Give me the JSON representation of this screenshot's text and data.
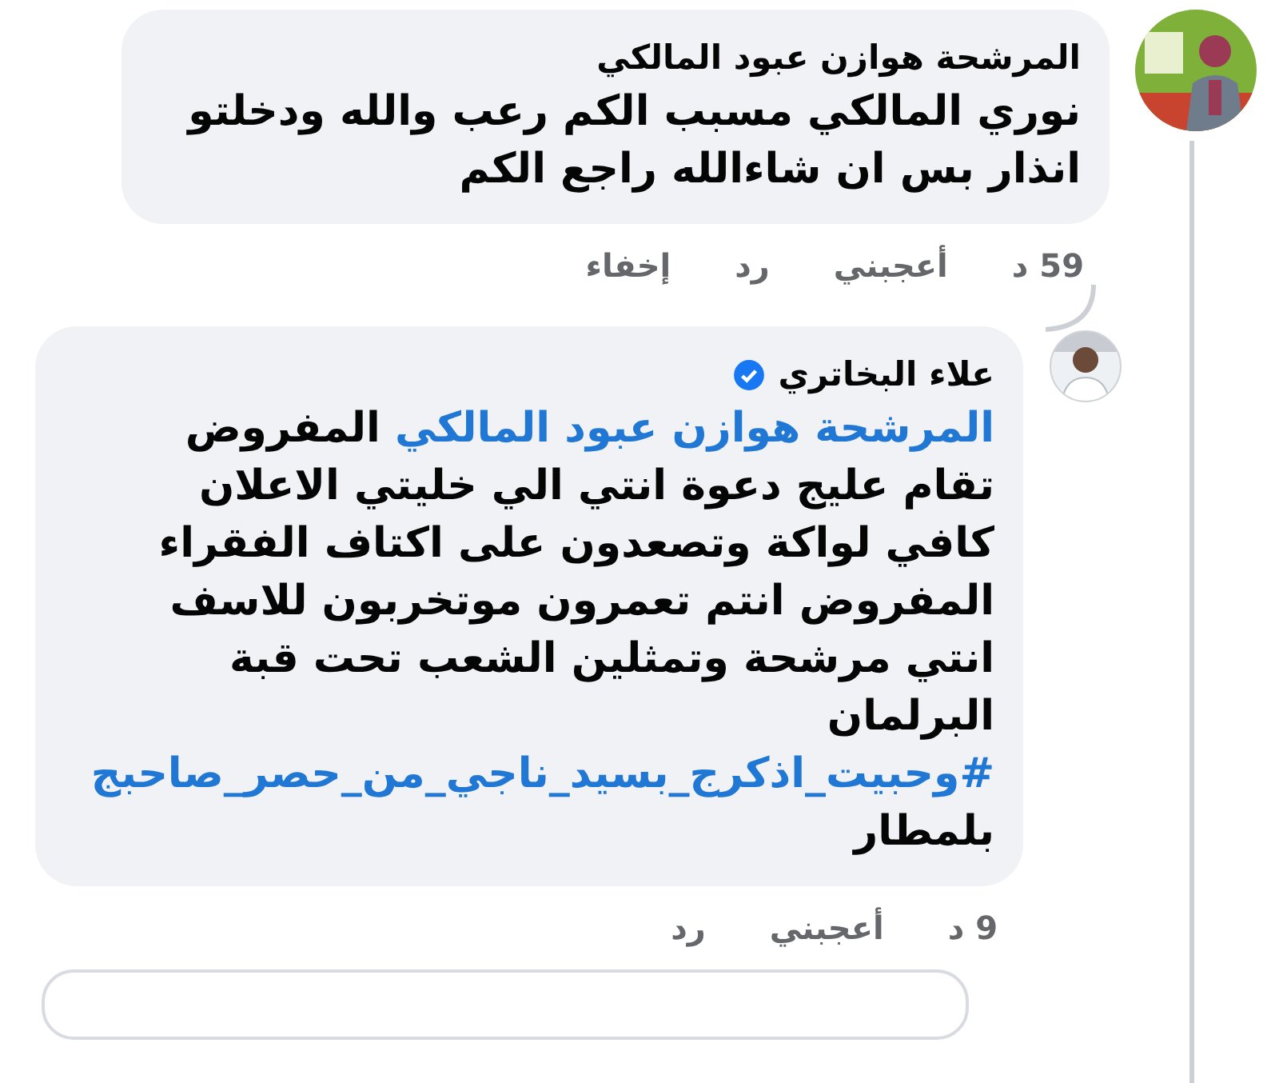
{
  "comments": [
    {
      "author": "المرشحة هوازن عبود المالكي",
      "verified": false,
      "body": [
        {
          "kind": "text",
          "text": "نوري المالكي مسبب الكم رعب والله ودخلتو انذار بس ان شاءالله راجع الكم"
        }
      ],
      "time": "59 د",
      "actions": [
        "أعجبني",
        "رد",
        "إخفاء"
      ],
      "replies": [
        {
          "author": "علاء البخاتري",
          "verified": true,
          "body": [
            {
              "kind": "mention",
              "text": "المرشحة هوازن عبود المالكي"
            },
            {
              "kind": "text",
              "text": " المفروض تقام  عليج دعوة انتي الي خليتي الاعلان كافي لواكة وتصعدون على اكتاف الفقراء المفروض انتم تعمرون موتخربون للاسف انتي مرشحة وتمثلين الشعب تحت قبة البرلمان "
            },
            {
              "kind": "hashtag",
              "text": "#وحبيت_اذكرج_بسيد_ناجي_من_حصر_"
            },
            {
              "kind": "hashtag",
              "text": "صاحبج"
            },
            {
              "kind": "text",
              "text": " بلمطار"
            }
          ],
          "time": "9 د",
          "actions": [
            "أعجبني",
            "رد"
          ]
        }
      ]
    }
  ]
}
